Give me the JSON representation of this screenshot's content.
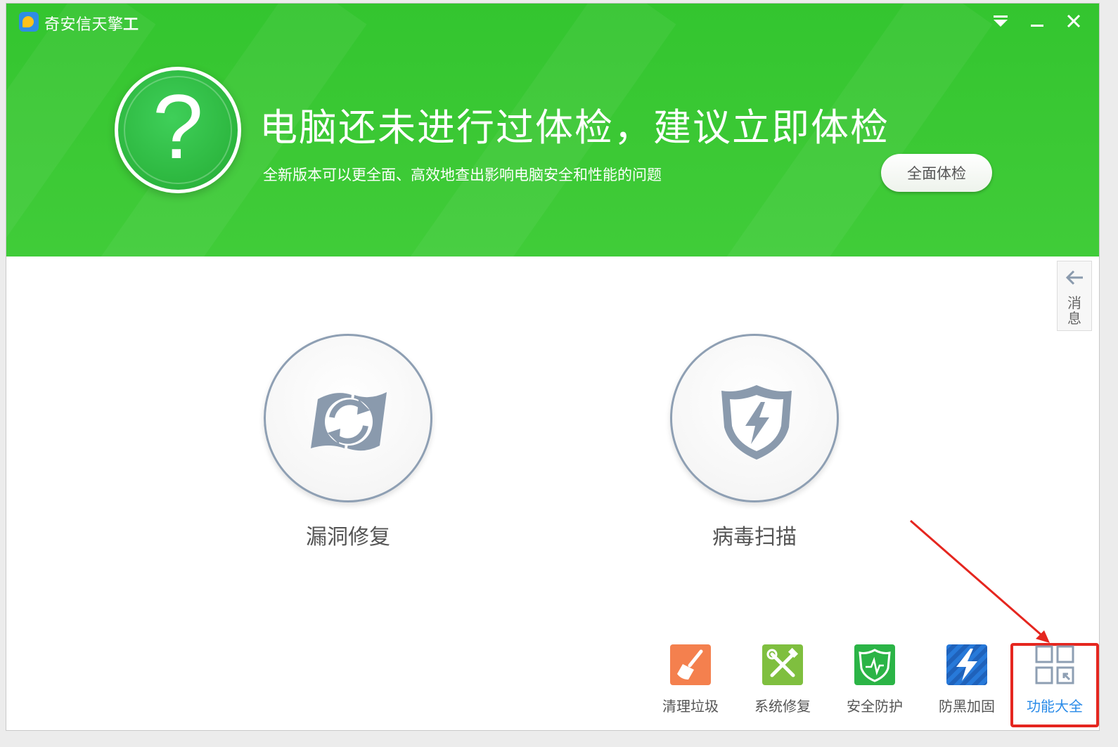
{
  "window": {
    "title": "奇安信天擎",
    "title_mark": "工"
  },
  "hero": {
    "icon": "question-mark-icon",
    "question_mark": "?",
    "title": "电脑还未进行过体检，建议立即体检",
    "subtitle": "全新版本可以更全面、高效地查出影响电脑安全和性能的问题",
    "button_label": "全面体检"
  },
  "message_tab": {
    "label_line1": "消",
    "label_line2": "息"
  },
  "main_tools": [
    {
      "label": "漏洞修复",
      "icon": "windows-repair-icon"
    },
    {
      "label": "病毒扫描",
      "icon": "shield-lightning-icon"
    }
  ],
  "bottom_tools": [
    {
      "label": "清理垃圾",
      "icon": "broom-icon",
      "color": "#f4804e"
    },
    {
      "label": "系统修复",
      "icon": "tools-icon",
      "color": "#7fbf3f"
    },
    {
      "label": "安全防护",
      "icon": "shield-icon",
      "color": "#2bb446"
    },
    {
      "label": "防黑加固",
      "icon": "lightning-shield-icon",
      "color": "#2779d9"
    },
    {
      "label": "功能大全",
      "icon": "grid-icon",
      "color": "#8e9fb3"
    }
  ],
  "colors": {
    "header_green": "#3cc935",
    "highlight_red": "#e5261f",
    "link_blue": "#2a8be8"
  }
}
